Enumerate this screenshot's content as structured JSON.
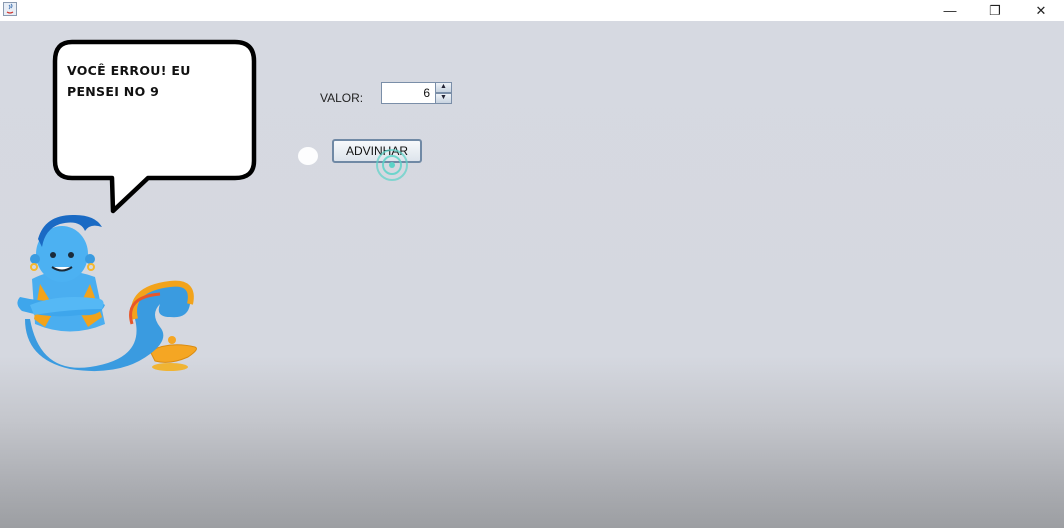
{
  "window": {
    "minimize_glyph": "—",
    "restore_glyph": "❐",
    "close_glyph": "✕"
  },
  "speech_bubble": {
    "line1": "VOCÊ ERROU! EU",
    "line2": "PENSEI NO 9"
  },
  "form": {
    "valor_label": "VALOR:",
    "spinner_value": "6",
    "spin_up_glyph": "▲",
    "spin_down_glyph": "▼",
    "advinhar_label": "ADVINHAR"
  },
  "icons": [
    "java-app-icon",
    "genie-icon",
    "speech-bubble"
  ]
}
